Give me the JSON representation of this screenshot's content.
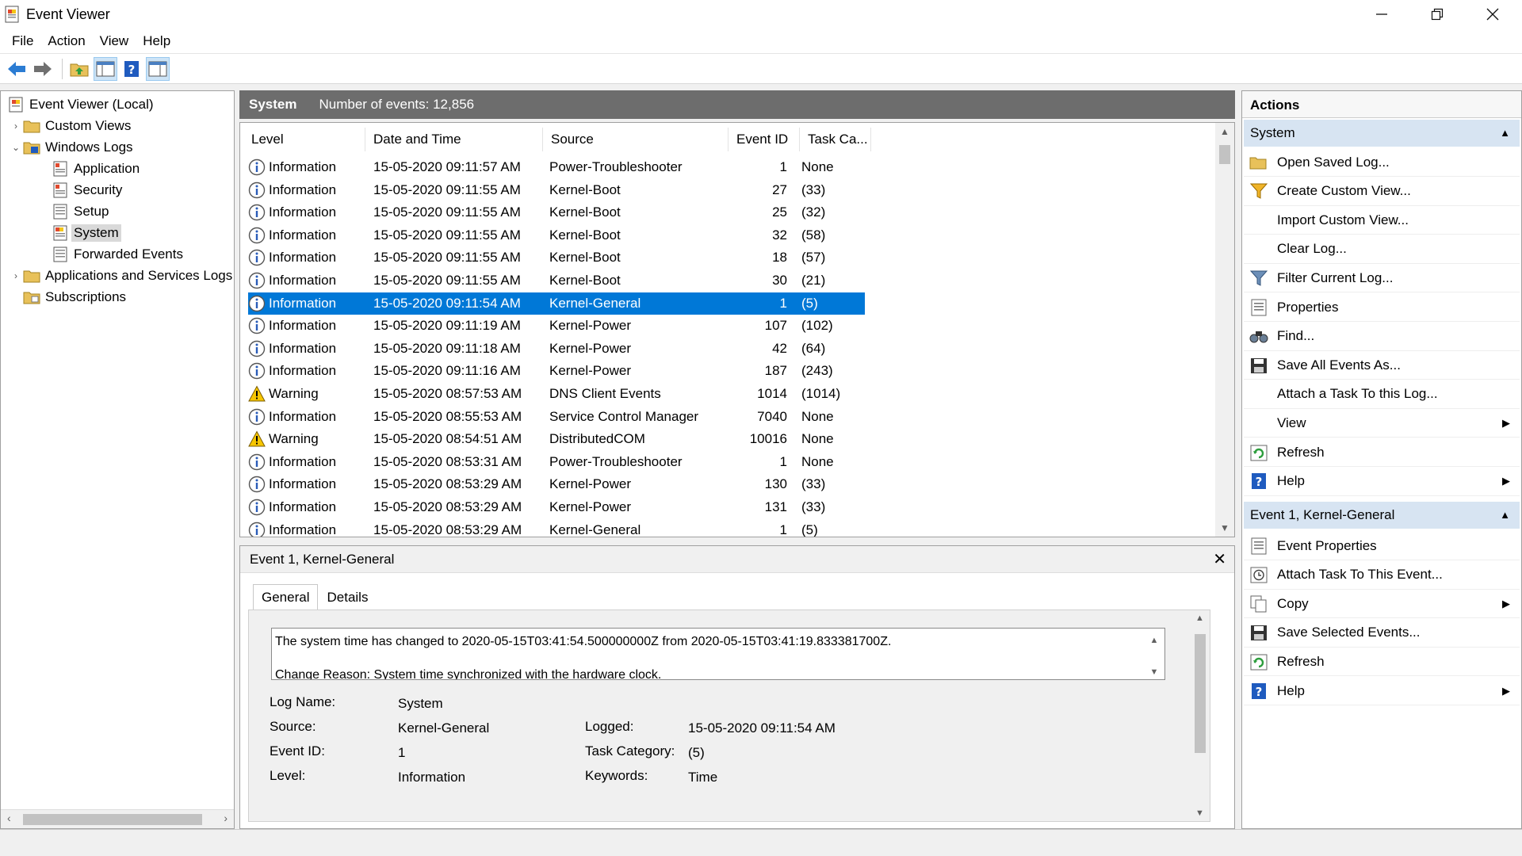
{
  "window": {
    "title": "Event Viewer"
  },
  "menu": [
    "File",
    "Action",
    "View",
    "Help"
  ],
  "tree": {
    "root": "Event Viewer (Local)",
    "custom_views": "Custom Views",
    "windows_logs": "Windows Logs",
    "logs": [
      "Application",
      "Security",
      "Setup",
      "System",
      "Forwarded Events"
    ],
    "apps_services": "Applications and Services Logs",
    "subscriptions": "Subscriptions"
  },
  "center": {
    "log_name": "System",
    "count_text": "Number of events: 12,856"
  },
  "columns": {
    "level": "Level",
    "date": "Date and Time",
    "source": "Source",
    "id": "Event ID",
    "task": "Task Ca..."
  },
  "events": [
    {
      "level": "Information",
      "date": "15-05-2020 09:11:57 AM",
      "source": "Power-Troubleshooter",
      "id": "1",
      "task": "None"
    },
    {
      "level": "Information",
      "date": "15-05-2020 09:11:55 AM",
      "source": "Kernel-Boot",
      "id": "27",
      "task": "(33)"
    },
    {
      "level": "Information",
      "date": "15-05-2020 09:11:55 AM",
      "source": "Kernel-Boot",
      "id": "25",
      "task": "(32)"
    },
    {
      "level": "Information",
      "date": "15-05-2020 09:11:55 AM",
      "source": "Kernel-Boot",
      "id": "32",
      "task": "(58)"
    },
    {
      "level": "Information",
      "date": "15-05-2020 09:11:55 AM",
      "source": "Kernel-Boot",
      "id": "18",
      "task": "(57)"
    },
    {
      "level": "Information",
      "date": "15-05-2020 09:11:55 AM",
      "source": "Kernel-Boot",
      "id": "30",
      "task": "(21)"
    },
    {
      "level": "Information",
      "date": "15-05-2020 09:11:54 AM",
      "source": "Kernel-General",
      "id": "1",
      "task": "(5)"
    },
    {
      "level": "Information",
      "date": "15-05-2020 09:11:19 AM",
      "source": "Kernel-Power",
      "id": "107",
      "task": "(102)"
    },
    {
      "level": "Information",
      "date": "15-05-2020 09:11:18 AM",
      "source": "Kernel-Power",
      "id": "42",
      "task": "(64)"
    },
    {
      "level": "Information",
      "date": "15-05-2020 09:11:16 AM",
      "source": "Kernel-Power",
      "id": "187",
      "task": "(243)"
    },
    {
      "level": "Warning",
      "date": "15-05-2020 08:57:53 AM",
      "source": "DNS Client Events",
      "id": "1014",
      "task": "(1014)"
    },
    {
      "level": "Information",
      "date": "15-05-2020 08:55:53 AM",
      "source": "Service Control Manager",
      "id": "7040",
      "task": "None"
    },
    {
      "level": "Warning",
      "date": "15-05-2020 08:54:51 AM",
      "source": "DistributedCOM",
      "id": "10016",
      "task": "None"
    },
    {
      "level": "Information",
      "date": "15-05-2020 08:53:31 AM",
      "source": "Power-Troubleshooter",
      "id": "1",
      "task": "None"
    },
    {
      "level": "Information",
      "date": "15-05-2020 08:53:29 AM",
      "source": "Kernel-Power",
      "id": "130",
      "task": "(33)"
    },
    {
      "level": "Information",
      "date": "15-05-2020 08:53:29 AM",
      "source": "Kernel-Power",
      "id": "131",
      "task": "(33)"
    },
    {
      "level": "Information",
      "date": "15-05-2020 08:53:29 AM",
      "source": "Kernel-General",
      "id": "1",
      "task": "(5)"
    }
  ],
  "detail": {
    "header": "Event 1, Kernel-General",
    "close": "✕",
    "tabs": [
      "General",
      "Details"
    ],
    "message_line1": "The system time has changed to 2020-05-15T03:41:54.500000000Z from 2020-05-15T03:41:19.833381700Z.",
    "message_line2": "Change Reason: System time synchronized with the hardware clock.",
    "fields": {
      "log_name_label": "Log Name:",
      "log_name": "System",
      "source_label": "Source:",
      "source": "Kernel-General",
      "logged_label": "Logged:",
      "logged": "15-05-2020 09:11:54 AM",
      "event_id_label": "Event ID:",
      "event_id": "1",
      "task_label": "Task Category:",
      "task": "(5)",
      "level_label": "Level:",
      "level": "Information",
      "keywords_label": "Keywords:",
      "keywords": "Time"
    }
  },
  "actions": {
    "title": "Actions",
    "section1": "System",
    "items1": [
      "Open Saved Log...",
      "Create Custom View...",
      "Import Custom View...",
      "Clear Log...",
      "Filter Current Log...",
      "Properties",
      "Find...",
      "Save All Events As...",
      "Attach a Task To this Log...",
      "View",
      "Refresh",
      "Help"
    ],
    "section2": "Event 1, Kernel-General",
    "items2": [
      "Event Properties",
      "Attach Task To This Event...",
      "Copy",
      "Save Selected Events...",
      "Refresh",
      "Help"
    ]
  },
  "colors": {
    "selection": "#0078d7",
    "section_bg": "#d7e4f2",
    "header_bg": "#6d6d6d"
  }
}
